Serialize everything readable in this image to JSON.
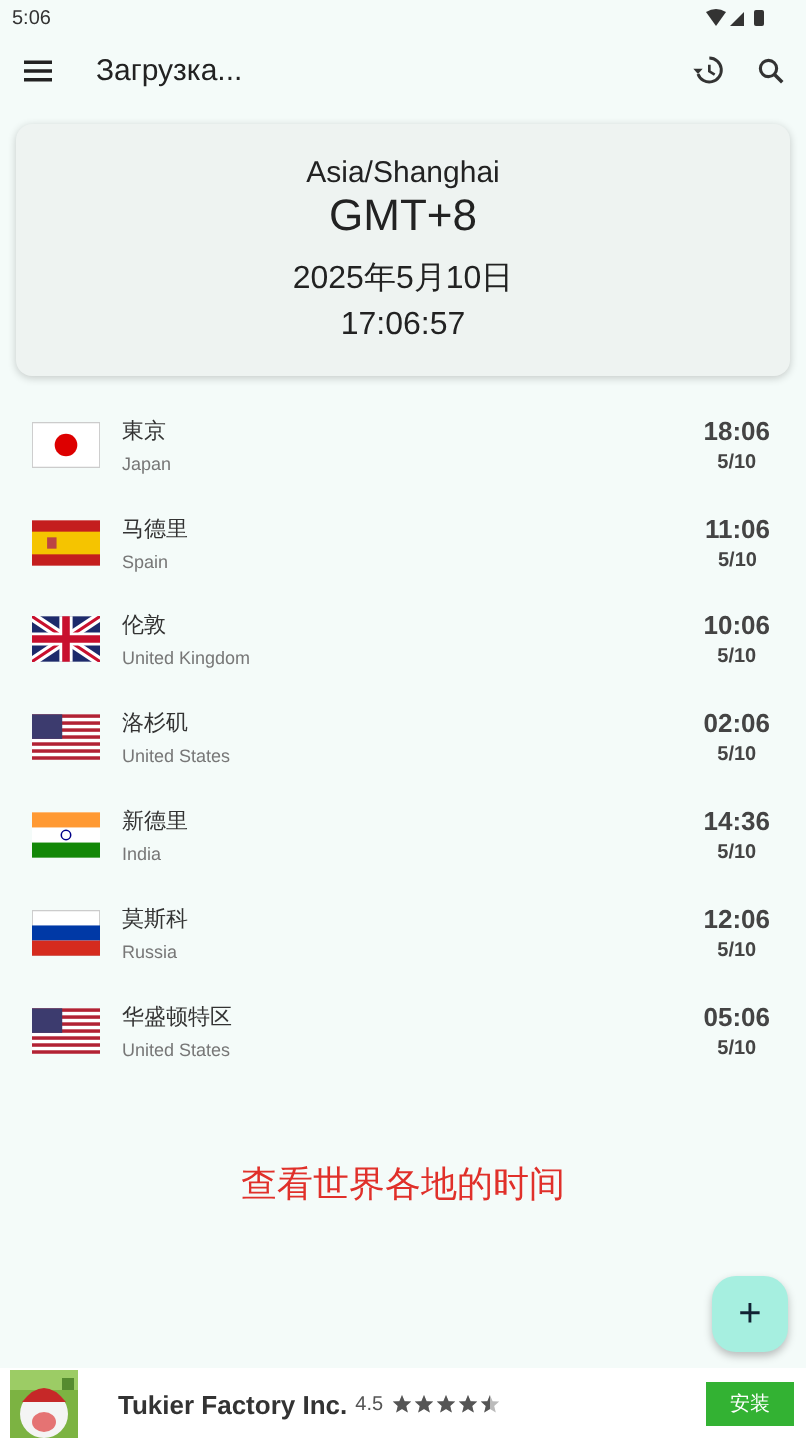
{
  "status_bar": {
    "time": "5:06"
  },
  "toolbar": {
    "title": "Загрузка..."
  },
  "current": {
    "zone": "Asia/Shanghai",
    "offset": "GMT+8",
    "date": "2025年5月10日",
    "time": "17:06:57"
  },
  "cities": [
    {
      "kind": "jp",
      "name": "東京",
      "country": "Japan",
      "time": "18:06",
      "date": "5/10"
    },
    {
      "kind": "es",
      "name": "马德里",
      "country": "Spain",
      "time": "11:06",
      "date": "5/10"
    },
    {
      "kind": "gb",
      "name": "伦敦",
      "country": "United Kingdom",
      "time": "10:06",
      "date": "5/10"
    },
    {
      "kind": "us",
      "name": "洛杉矶",
      "country": "United States",
      "time": "02:06",
      "date": "5/10"
    },
    {
      "kind": "in",
      "name": "新德里",
      "country": "India",
      "time": "14:36",
      "date": "5/10"
    },
    {
      "kind": "ru",
      "name": "莫斯科",
      "country": "Russia",
      "time": "12:06",
      "date": "5/10"
    },
    {
      "kind": "us",
      "name": "华盛顿特区",
      "country": "United States",
      "time": "05:06",
      "date": "5/10"
    }
  ],
  "caption": "查看世界各地的时间",
  "fab": {
    "label": "+"
  },
  "ad": {
    "kind": "picture",
    "title": "Tukier Factory Inc.",
    "rating": "4.5",
    "stars": 4.5,
    "button": "安装"
  }
}
